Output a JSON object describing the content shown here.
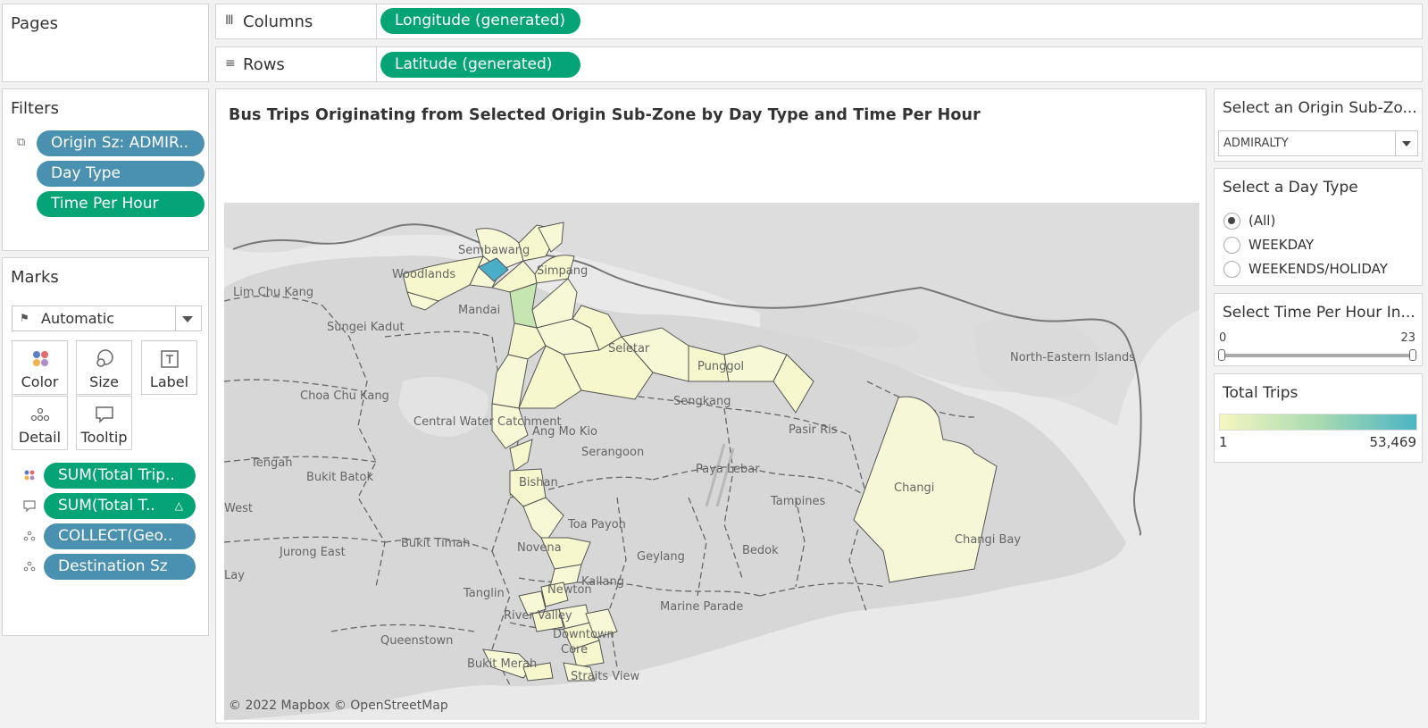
{
  "pages": {
    "title": "Pages"
  },
  "shelves": {
    "columns_label": "Columns",
    "columns_pill": "Longitude (generated)",
    "rows_label": "Rows",
    "rows_pill": "Latitude (generated)"
  },
  "filters": {
    "title": "Filters",
    "items": [
      "Origin Sz: ADMIR..",
      "Day Type",
      "Time Per Hour"
    ]
  },
  "marks": {
    "title": "Marks",
    "type": "Automatic",
    "buttons": [
      "Color",
      "Size",
      "Label",
      "Detail",
      "Tooltip"
    ],
    "fields": [
      "SUM(Total Trip..",
      "SUM(Total T..",
      "COLLECT(Geo..",
      "Destination Sz"
    ]
  },
  "viz": {
    "title": "Bus Trips Originating from Selected Origin Sub-Zone by Day Type and Time Per Hour",
    "attribution": "© 2022 Mapbox © OpenStreetMap",
    "place_labels": [
      "Sembawang",
      "Woodlands",
      "Simpang",
      "Lim Chu Kang",
      "Mandai",
      "Sungei Kadut",
      "Seletar",
      "Punggol",
      "Sengkang",
      "North-Eastern Islands",
      "Choa Chu Kang",
      "Central Water Catchment",
      "Ang Mo Kio",
      "Serangoon",
      "Pasir Ris",
      "Tengah",
      "Bukit Batok",
      "Paya Lebar",
      "Bishan",
      "Tampines",
      "Changi",
      "West",
      "Changi Bay",
      "Toa Payoh",
      "Jurong East",
      "Bukit Timah",
      "Novena",
      "Geylang",
      "Bedok",
      "Lay",
      "Tanglin",
      "Newton",
      "Kallang",
      "Marine Parade",
      "River Valley",
      "Queenstown",
      "Downtown",
      "Core",
      "Bukit Merah",
      "Straits View"
    ]
  },
  "origin_param": {
    "title": "Select an Origin Sub-Zo...",
    "value": "ADMIRALTY"
  },
  "day_type": {
    "title": "Select a Day Type",
    "options": [
      "(All)",
      "WEEKDAY",
      "WEEKENDS/HOLIDAY"
    ],
    "selected": "(All)"
  },
  "time_slider": {
    "title": "Select Time Per Hour In...",
    "min_label": "0",
    "max_label": "23",
    "min": 0,
    "max": 23
  },
  "legend": {
    "title": "Total Trips",
    "min_label": "1",
    "max_label": "53,469",
    "color_start": "#f6f7c0",
    "color_end": "#4cb5c4"
  }
}
